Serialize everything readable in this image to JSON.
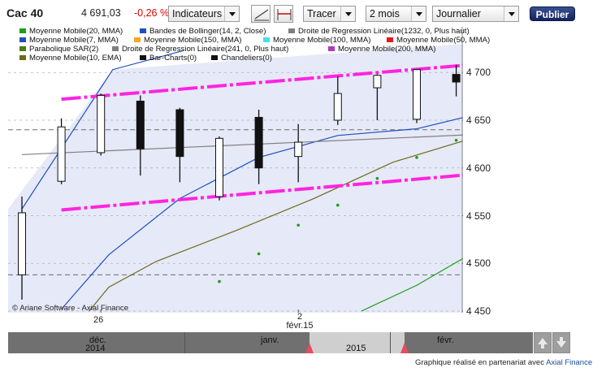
{
  "toolbar": {
    "instrument": "Cac 40",
    "price": "4 691,03",
    "change": "-0,26 %",
    "indicators_label": "Indicateurs",
    "draw_label": "Tracer",
    "period_label": "2 mois",
    "interval_label": "Journalier",
    "publish_label": "Publier"
  },
  "legend": [
    {
      "label": "Moyenne Mobile(20, MMA)",
      "color": "#1a9e1a"
    },
    {
      "label": "Bandes de Bollinger(14, 2, Close)",
      "color": "#1f4fbf"
    },
    {
      "label": "Droite de Regression Linéaire(1232, 0, Plus haut)",
      "color": "#7f7f7f"
    },
    {
      "label": "Moyenne Mobile(7, MMA)",
      "color": "#1f4fbf"
    },
    {
      "label": "Moyenne Mobile(150, MMA)",
      "color": "#f5a623"
    },
    {
      "label": "Moyenne Mobile(100, MMA)",
      "color": "#3fe0f0"
    },
    {
      "label": "Moyenne Mobile(50, MMA)",
      "color": "#e8141e"
    },
    {
      "label": "Parabolique SAR(2)",
      "color": "#4a7a1a"
    },
    {
      "label": "Droite de Regression Linéaire(241, 0, Plus haut)",
      "color": "#7f7f7f"
    },
    {
      "label": "Moyenne Mobile(200, MMA)",
      "color": "#b03bb8"
    },
    {
      "label": "Moyenne Mobile(10, EMA)",
      "color": "#6b6b1a"
    },
    {
      "label": "Bar-Charts(0)",
      "color": "#111111"
    },
    {
      "label": "Chandeliers(0)",
      "color": "#111111"
    }
  ],
  "copyright": "© Ariane Software - Axial Finance",
  "credit": {
    "text": "Graphique réalisé en partenariat avec",
    "link": "Axial Finance"
  },
  "navigator": {
    "labels": [
      "déc.",
      "2014",
      "janv.",
      "2015",
      "févr."
    ]
  },
  "colors": {
    "plot_background": "#e6e9f7",
    "channel": "#ff24e0",
    "bollinger": "#1f4fbf",
    "navigator": "#707070",
    "navigator_window": "#cfcfcf",
    "publish_button": "#1b2d6b"
  },
  "chart_data": {
    "type": "candlestick",
    "ylim": [
      4440,
      4730
    ],
    "y_ticks": [
      4450,
      4500,
      4550,
      4600,
      4650,
      4700
    ],
    "y_tick_labels": [
      "4 450",
      "4 500",
      "4 550",
      "4 600",
      "4 650",
      "4 700"
    ],
    "x_tick_labels": [
      {
        "label": "26",
        "index": 2
      },
      {
        "label": "2\nfévr.15",
        "index": 7
      }
    ],
    "grid": "horizontal dashed",
    "candles": [
      {
        "open": 4488,
        "high": 4570,
        "low": 4462,
        "close": 4553
      },
      {
        "open": 4586,
        "high": 4652,
        "low": 4583,
        "close": 4643
      },
      {
        "open": 4616,
        "high": 4678,
        "low": 4613,
        "close": 4676
      },
      {
        "open": 4670,
        "high": 4676,
        "low": 4592,
        "close": 4620
      },
      {
        "open": 4661,
        "high": 4663,
        "low": 4585,
        "close": 4612
      },
      {
        "open": 4570,
        "high": 4633,
        "low": 4566,
        "close": 4631
      },
      {
        "open": 4653,
        "high": 4661,
        "low": 4583,
        "close": 4600
      },
      {
        "open": 4612,
        "high": 4646,
        "low": 4585,
        "close": 4627
      },
      {
        "open": 4650,
        "high": 4696,
        "low": 4645,
        "close": 4678
      },
      {
        "open": 4684,
        "high": 4698,
        "low": 4650,
        "close": 4697
      },
      {
        "open": 4651,
        "high": 4703,
        "low": 4647,
        "close": 4703
      },
      {
        "open": 4698,
        "high": 4708,
        "low": 4675,
        "close": 4690
      }
    ],
    "series": [
      {
        "name": "Bandes de Bollinger(14, 2, Close)",
        "values": [
          [
            0,
            4557
          ],
          [
            2.3,
            4703
          ],
          [
            4.1,
            4723
          ]
        ]
      },
      {
        "name": "Moyenne Mobile(7, MMA)",
        "values": [
          [
            1,
            4452
          ],
          [
            2.2,
            4509
          ],
          [
            4,
            4568
          ],
          [
            6,
            4611
          ],
          [
            8,
            4634
          ],
          [
            10,
            4641
          ],
          [
            12,
            4661
          ]
        ]
      },
      {
        "name": "Moyenne Mobile(10, EMA)",
        "values": [
          [
            1.7,
            4450
          ],
          [
            2.2,
            4475
          ],
          [
            3.4,
            4502
          ],
          [
            5.4,
            4534
          ],
          [
            7.4,
            4568
          ],
          [
            9.4,
            4606
          ],
          [
            11.4,
            4631
          ],
          [
            12,
            4636
          ]
        ]
      },
      {
        "name": "Moyenne Mobile(20, MMA)",
        "values": [
          [
            8.6,
            4450
          ],
          [
            10,
            4477
          ],
          [
            12,
            4525
          ]
        ]
      },
      {
        "name": "Droite de Regression Linéaire(1232, 0, Plus haut)",
        "values": [
          [
            0,
            4614
          ],
          [
            12,
            4636
          ]
        ]
      },
      {
        "name": "Parabolique SAR(2)",
        "values": [
          [
            5,
            4481
          ],
          [
            6,
            4510
          ],
          [
            7,
            4540
          ],
          [
            8,
            4561
          ],
          [
            9,
            4589
          ],
          [
            10,
            4611
          ],
          [
            11,
            4629
          ]
        ]
      }
    ],
    "channel": {
      "upper": [
        [
          1,
          4672
        ],
        [
          11.9,
          4710
        ]
      ],
      "lower": [
        [
          1,
          4556
        ],
        [
          11.9,
          4595
        ]
      ]
    },
    "reference_lines": [
      4640,
      4488
    ]
  }
}
